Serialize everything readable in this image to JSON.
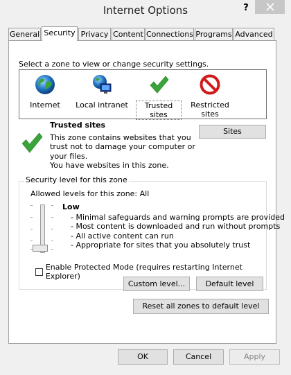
{
  "window": {
    "title": "Internet Options",
    "help_label": "?",
    "close_icon": "close-icon"
  },
  "tabs": [
    {
      "label": "General"
    },
    {
      "label": "Security"
    },
    {
      "label": "Privacy"
    },
    {
      "label": "Content"
    },
    {
      "label": "Connections"
    },
    {
      "label": "Programs"
    },
    {
      "label": "Advanced"
    }
  ],
  "active_tab": "Security",
  "zones": {
    "prompt": "Select a zone to view or change security settings.",
    "items": [
      {
        "label": "Internet",
        "icon": "globe-icon"
      },
      {
        "label": "Local intranet",
        "icon": "intranet-icon"
      },
      {
        "label": "Trusted sites",
        "icon": "checkmark-icon"
      },
      {
        "label": "Restricted sites",
        "label_lines": [
          "Restricted",
          "sites"
        ],
        "icon": "restricted-icon"
      }
    ],
    "selected": "Trusted sites"
  },
  "zone_info": {
    "title": "Trusted sites",
    "description_lines": [
      "This zone contains websites that you",
      "trust not to damage your computer or",
      "your files.",
      "You have websites in this zone."
    ],
    "sites_button": "Sites"
  },
  "security_level": {
    "group_label": "Security level for this zone",
    "allowed_levels": "Allowed levels for this zone: All",
    "level_name": "Low",
    "slider_level": "lowest (1 of 5)",
    "bullets": [
      "- Minimal safeguards and warning prompts are provided",
      "- Most content is downloaded and run without prompts",
      "- All active content can run",
      "- Appropriate for sites that you absolutely trust"
    ],
    "protected_mode_label": "Enable Protected Mode (requires restarting Internet Explorer)",
    "protected_mode_checked": false,
    "custom_level_button": "Custom level...",
    "default_level_button": "Default level"
  },
  "reset_button": "Reset all zones to default level",
  "footer": {
    "ok": "OK",
    "cancel": "Cancel",
    "apply": "Apply"
  },
  "colors": {
    "dialog_bg": "#f0f0f0",
    "panel_bg": "#ffffff",
    "checkmark_green": "#3aa43a",
    "restricted_red": "#d11a1a",
    "globe_blue": "#1f73c4"
  }
}
